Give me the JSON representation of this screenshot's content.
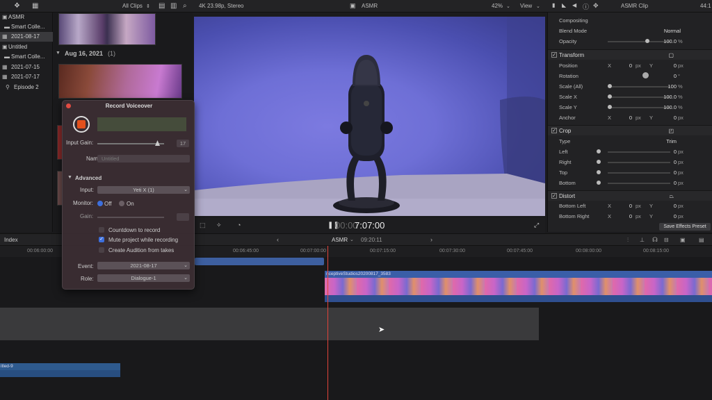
{
  "topbar": {
    "all_clips": "All Clips",
    "format": "4K 23.98p, Stereo",
    "project": "ASMR",
    "zoom": "42%",
    "view": "View",
    "timecode_right": "44:1",
    "inspector_title": "ASMR Clip"
  },
  "library": [
    {
      "label": "ASMR",
      "icon": "film"
    },
    {
      "label": "Smart Colle...",
      "icon": "folder"
    },
    {
      "label": "2021-08-17",
      "icon": "event",
      "selected": true
    },
    {
      "label": "Untitled",
      "icon": "film"
    },
    {
      "label": "Smart Colle...",
      "icon": "folder"
    },
    {
      "label": "2021-07-15",
      "icon": "event"
    },
    {
      "label": "2021-07-17",
      "icon": "event"
    },
    {
      "label": "Episode 2",
      "icon": "key"
    }
  ],
  "browser": {
    "date_header": "Aug 16, 2021",
    "date_count": "(1)"
  },
  "viewer": {
    "timecode": "7:07:00",
    "timecode_dim": "00:00"
  },
  "inspector": {
    "compositing": "Compositing",
    "blend_mode_label": "Blend Mode",
    "blend_mode_value": "Normal",
    "opacity_label": "Opacity",
    "opacity_value": "100.0",
    "pct": "%",
    "transform": "Transform",
    "position": "Position",
    "rotation": "Rotation",
    "scale_all": "Scale (All)",
    "scale_x": "Scale X",
    "scale_y": "Scale Y",
    "anchor": "Anchor",
    "crop": "Crop",
    "type": "Type",
    "type_value": "Trim",
    "left": "Left",
    "right": "Right",
    "top": "Top",
    "bottom": "Bottom",
    "distort": "Distort",
    "bottom_left": "Bottom Left",
    "bottom_right": "Bottom Right",
    "x": "X",
    "y": "Y",
    "zero": "0",
    "px": "px",
    "deg": "°",
    "hundred": "100",
    "hundred_dec": "100.0",
    "save_preset": "Save Effects Preset"
  },
  "timeline": {
    "index": "Index",
    "project": "ASMR",
    "duration": "09:20:11",
    "ticks": [
      "00:06:00:00",
      "00:06:45:00",
      "00:07:00:00",
      "00:07:15:00",
      "00:07:30:00",
      "00:07:45:00",
      "00:08:00:00",
      "00:08:15:00"
    ],
    "clip_name": "nceptiveStudios20200817_3583",
    "audio_clip_name": "itled-9"
  },
  "voiceover": {
    "title": "Record Voiceover",
    "input_gain_label": "Input Gain:",
    "input_gain_value": "17",
    "name_label": "Name:",
    "name_placeholder": "Untitled",
    "advanced": "Advanced",
    "input_label": "Input:",
    "input_value": "Yeti X (1)",
    "monitor_label": "Monitor:",
    "monitor_off": "Off",
    "monitor_on": "On",
    "gain_label": "Gain:",
    "countdown": "Countdown to record",
    "mute": "Mute project while recording",
    "audition": "Create Audition from takes",
    "event_label": "Event:",
    "event_value": "2021-08-17",
    "role_label": "Role:",
    "role_value": "Dialogue-1"
  }
}
